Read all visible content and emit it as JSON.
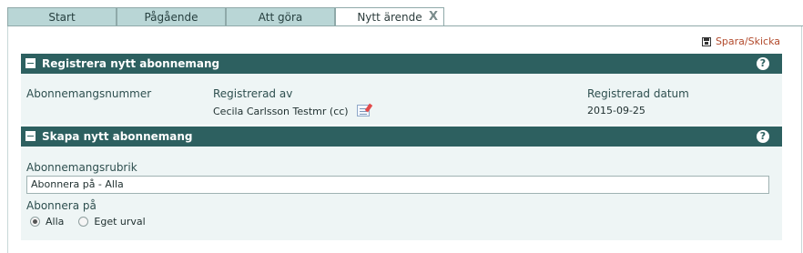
{
  "tabs": [
    {
      "label": "Start"
    },
    {
      "label": "Pågående"
    },
    {
      "label": "Att göra"
    },
    {
      "label": "Nytt ärende",
      "active": true,
      "close": "X"
    }
  ],
  "toolbar": {
    "save_label": "Spara/Skicka"
  },
  "section_register": {
    "title": "Registrera nytt abonnemang",
    "help": "?",
    "fields": {
      "number_label": "Abonnemangsnummer",
      "registered_by_label": "Registrerad av",
      "registered_by_value": "Cecila Carlsson Testmr (cc)",
      "registered_date_label": "Registrerad datum",
      "registered_date_value": "2015-09-25"
    }
  },
  "section_create": {
    "title": "Skapa nytt abonnemang",
    "help": "?",
    "heading_label": "Abonnemangsrubrik",
    "heading_value": "Abonnera på - Alla",
    "subscribe_label": "Abonnera på",
    "options": [
      {
        "label": "Alla",
        "selected": true
      },
      {
        "label": "Eget urval",
        "selected": false
      }
    ]
  }
}
